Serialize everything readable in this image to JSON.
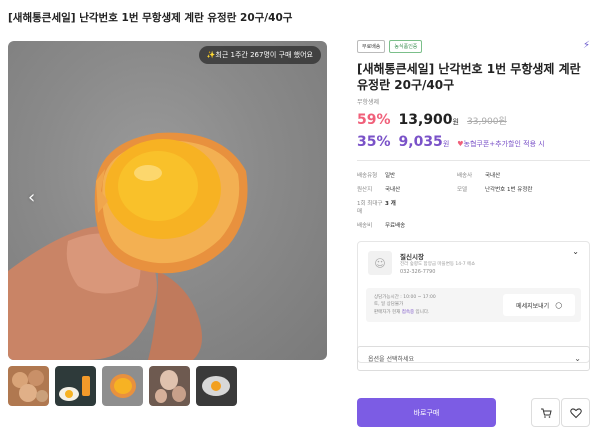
{
  "product": {
    "title": "[새해통큰세일] 난각번호 1번 무항생제 계란 유정란 20구/40구",
    "name": "[새해통큰세일] 난각번호 1번 무항생제 계란 유정란 20구/40구",
    "sub_name": "무항생제"
  },
  "gallery": {
    "purchase_badge": "✨최근 1주간 267명이 구매 했어요",
    "prev_icon": "chevron-left-icon",
    "next_icon": "chevron-right-icon"
  },
  "tags": [
    "무료배송",
    "농식품인증"
  ],
  "price": {
    "discount": "59%",
    "sale_price": "13,900",
    "won": "원",
    "original_price": "33,900원",
    "coupon_discount": "35%",
    "coupon_price": "9,035",
    "coupon_won": "원",
    "coupon_text": "농협쿠폰+추가할인 적용 시"
  },
  "info": {
    "rows": [
      {
        "k1": "배송유형",
        "v1": "일반",
        "k2": "배송사",
        "v2": "국내산"
      },
      {
        "k1": "원산지",
        "v1": "국내산",
        "k2": "모델",
        "v2": "난각번호 1번 유정란"
      },
      {
        "k1": "1회 최대구매",
        "v1": "3 개",
        "k2": "",
        "v2": ""
      },
      {
        "k1": "배송비",
        "v1": "무료배송",
        "k2": "",
        "v2": ""
      }
    ]
  },
  "seller": {
    "name": "질신시장",
    "address": "전라 숲향도 함양금 마을변동 14-7 에쇼",
    "phone": "032-326-7790",
    "consult_hours_1": "상담가능시간 : 10:00 ~ 17:00",
    "consult_hours_2": "토, 일 상담불가",
    "status_prefix": "판매자가 현재 ",
    "status_accent": "접속중",
    "status_suffix": " 입니다.",
    "message_button": "메세지보내기"
  },
  "option": {
    "placeholder": "옵션을 선택하세요"
  },
  "actions": {
    "buy": "바로구매"
  },
  "colors": {
    "accent": "#7c5ce4",
    "discount": "#f0607a",
    "coupon": "#7a52c8"
  }
}
